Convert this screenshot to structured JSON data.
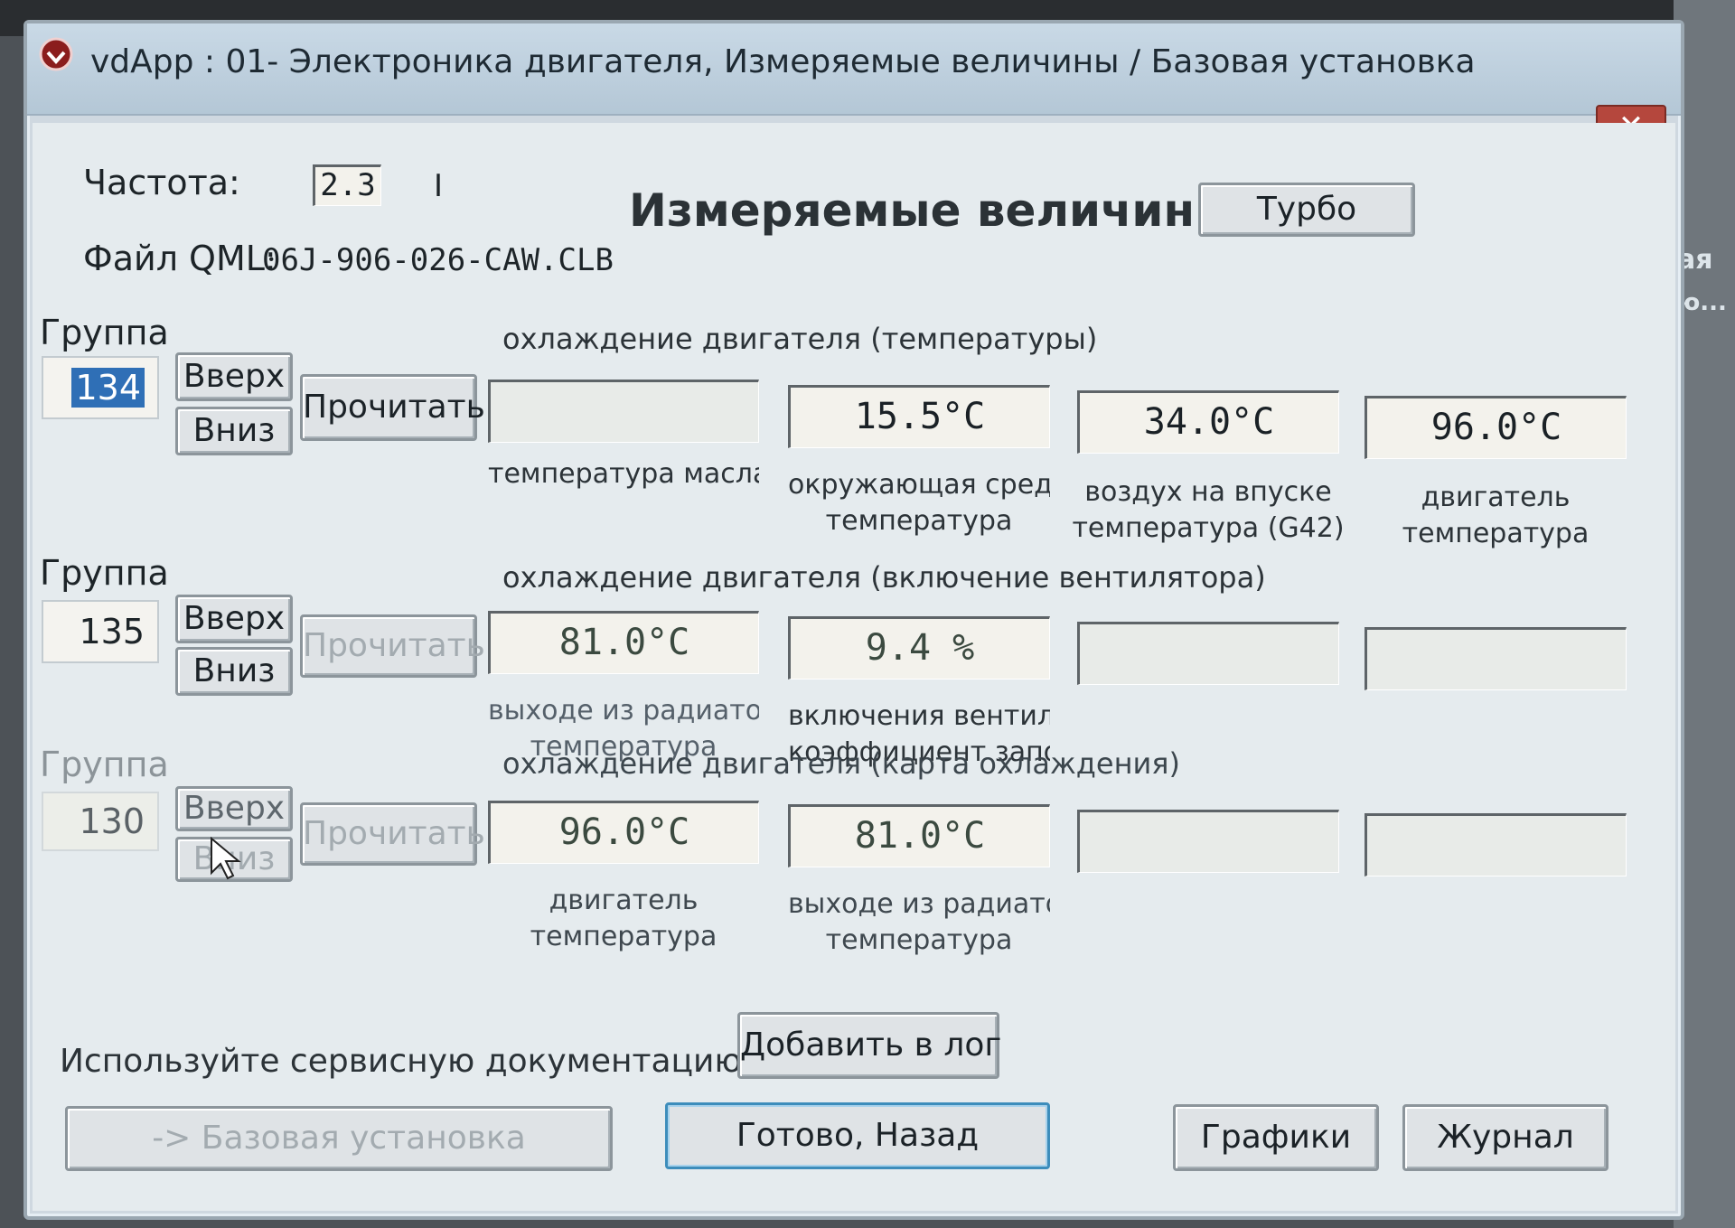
{
  "window": {
    "title": "vdApp : 01- Электроника двигателя,  Измеряемые величины / Базовая установка",
    "close_label": "✕"
  },
  "side": {
    "text1": "ая",
    "text2": "ю..."
  },
  "header": {
    "freq_label": "Частота:",
    "freq_value": "2.3",
    "freq_marker": "I",
    "file_label": "Файл QML:",
    "file_value": "06J-906-026-CAW.CLB",
    "heading": "Измеряемые величины",
    "turbo_label": "Турбо"
  },
  "groups": [
    {
      "label": "Группа",
      "number": "134",
      "up_label": "Вверх",
      "down_label": "Вниз",
      "read_label": "Прочитать",
      "title": "охлаждение двигателя (температуры)",
      "fields": [
        {
          "value": "",
          "caption1": "температура масла",
          "caption2": ""
        },
        {
          "value": "15.5°C",
          "caption1": "окружающая среда",
          "caption2": "температура"
        },
        {
          "value": "34.0°C",
          "caption1": "воздух на впуске",
          "caption2": "температура (G42)"
        },
        {
          "value": "96.0°C",
          "caption1": "двигатель",
          "caption2": "температура"
        }
      ]
    },
    {
      "label": "Группа",
      "number": "135",
      "up_label": "Вверх",
      "down_label": "Вниз",
      "read_label": "Прочитать",
      "title": "охлаждение двигателя (включение вентилятора)",
      "fields": [
        {
          "value": "81.0°C",
          "caption1": "выходе из радиатора",
          "caption2": "температура"
        },
        {
          "value": "9.4 %",
          "caption1": "включения вентилятора",
          "caption2": "коэффициент заполнения"
        },
        {
          "value": "",
          "caption1": "",
          "caption2": ""
        },
        {
          "value": "",
          "caption1": "",
          "caption2": ""
        }
      ]
    },
    {
      "label": "Группа",
      "number": "130",
      "up_label": "Вверх",
      "down_label": "Вниз",
      "read_label": "Прочитать",
      "title": "охлаждение двигателя (карта охлаждения)",
      "fields": [
        {
          "value": "96.0°C",
          "caption1": "двигатель",
          "caption2": "температура"
        },
        {
          "value": "81.0°C",
          "caption1": "выходе из радиатора",
          "caption2": "температура"
        },
        {
          "value": "",
          "caption1": "",
          "caption2": ""
        },
        {
          "value": "",
          "caption1": "",
          "caption2": ""
        }
      ]
    }
  ],
  "footer": {
    "notice": "Используйте сервисную документацию!",
    "add_log_label": "Добавить в лог",
    "basic_setting_label": "-> Базовая установка",
    "done_label": "Готово, Назад",
    "graphs_label": "Графики",
    "journal_label": "Журнал"
  }
}
